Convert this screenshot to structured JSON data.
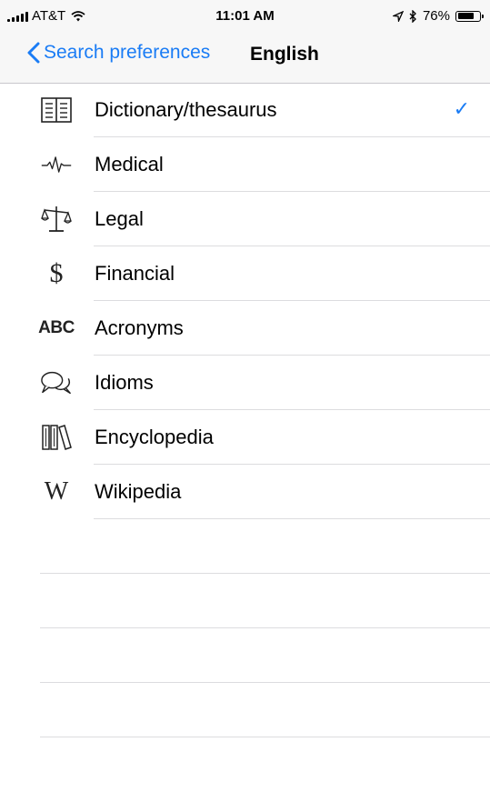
{
  "status_bar": {
    "carrier": "AT&T",
    "time": "11:01 AM",
    "battery": "76%",
    "battery_level": 0.76
  },
  "nav": {
    "back_label": "Search preferences",
    "title": "English"
  },
  "sources": [
    {
      "label": "Dictionary/thesaurus",
      "icon": "book-icon",
      "checked": true
    },
    {
      "label": "Medical",
      "icon": "heartbeat-icon",
      "checked": false
    },
    {
      "label": "Legal",
      "icon": "scales-icon",
      "checked": false
    },
    {
      "label": "Financial",
      "icon": "dollar-icon",
      "checked": false
    },
    {
      "label": "Acronyms",
      "icon": "abc-icon",
      "checked": false
    },
    {
      "label": "Idioms",
      "icon": "speech-bubbles-icon",
      "checked": false
    },
    {
      "label": "Encyclopedia",
      "icon": "books-icon",
      "checked": false
    },
    {
      "label": "Wikipedia",
      "icon": "wikipedia-icon",
      "checked": false
    }
  ],
  "checkmark": "✓",
  "colors": {
    "accent": "#1a7cf5",
    "separator": "#dcdcdf",
    "navbar_bg": "#f7f7f7"
  }
}
